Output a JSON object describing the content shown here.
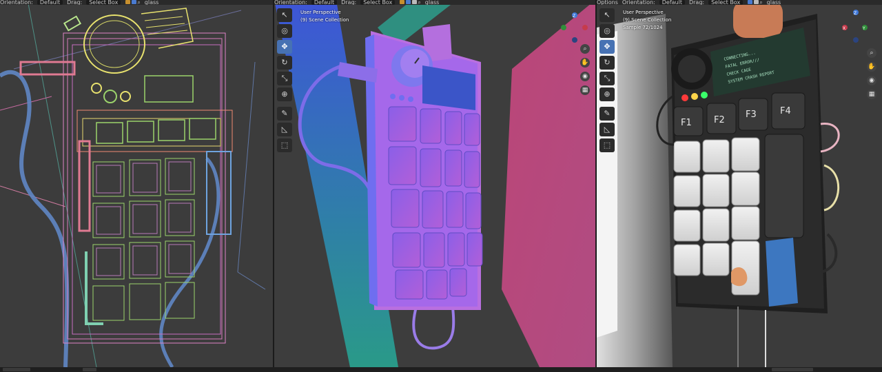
{
  "viewports": {
    "left": {
      "header": {
        "orientation_label": "Orientation:",
        "orientation_value": "Default",
        "drag_label": "Drag:",
        "drag_value": "Select Box",
        "search_value": "glass"
      }
    },
    "middle": {
      "header": {
        "orientation_label": "Orientation:",
        "orientation_value": "Default",
        "drag_label": "Drag:",
        "drag_value": "Select Box",
        "search_value": "glass"
      },
      "overlay": {
        "perspective": "User Perspective",
        "collection": "(9) Scene Collection"
      }
    },
    "right": {
      "header": {
        "options_label": "Options",
        "orientation_label": "Orientation:",
        "orientation_value": "Default",
        "drag_label": "Drag:",
        "drag_value": "Select Box",
        "search_value": "glass"
      },
      "overlay": {
        "perspective": "User Perspective",
        "collection": "(9) Scene Collection",
        "sample": "Sample 72/1024"
      },
      "device": {
        "screen_lines": [
          "CONNECTING...",
          "FATAL ERROR///",
          "CHECK CAGE",
          "SYSTEM CRASH REPORT"
        ],
        "fkeys": [
          "F1",
          "F2",
          "F3",
          "F4"
        ]
      }
    }
  },
  "gizmo": {
    "z": "Z",
    "y": "Y",
    "x": "X"
  },
  "colors": {
    "accent": "#4772b3",
    "viewport_bg": "#3d3d3d",
    "header_bg": "#2a2a2a",
    "normal_blue": "#6f6ef0",
    "normal_pink": "#c24b7e",
    "wire_green": "#9bd36b",
    "wire_pink": "#e085c8",
    "wire_yellow": "#e8e26e"
  }
}
